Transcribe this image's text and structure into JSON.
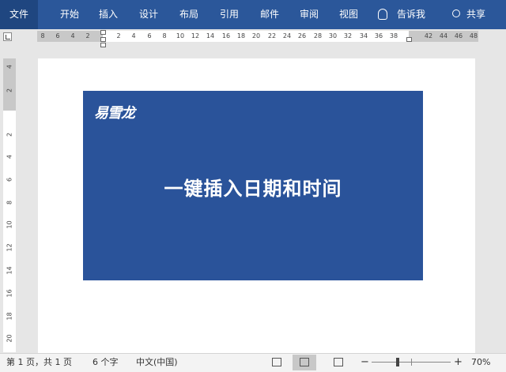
{
  "ribbon": {
    "tabs": [
      "文件",
      "开始",
      "插入",
      "设计",
      "布局",
      "引用",
      "邮件",
      "审阅",
      "视图"
    ],
    "tell_me": "告诉我",
    "share": "共享"
  },
  "ruler": {
    "left_ticks": [
      "8",
      "6",
      "4",
      "2"
    ],
    "main_ticks": [
      "2",
      "4",
      "6",
      "8",
      "10",
      "12",
      "14",
      "16",
      "18",
      "20",
      "22",
      "24",
      "26",
      "28",
      "30",
      "32",
      "34",
      "36",
      "38"
    ],
    "right_ticks": [
      "42",
      "44",
      "46",
      "48"
    ],
    "vertical_ticks": [
      "4",
      "2",
      "2",
      "4",
      "6",
      "8",
      "10",
      "12",
      "14",
      "16",
      "18",
      "20"
    ]
  },
  "document": {
    "banner": {
      "brand": "易雪龙",
      "headline": "一键插入日期和时间",
      "background": "#2a539a"
    }
  },
  "status_bar": {
    "page_info": "第 1 页，共 1 页",
    "word_count": "6 个字",
    "language": "中文(中国)",
    "zoom_minus": "−",
    "zoom_plus": "+",
    "zoom": "70%"
  },
  "colors": {
    "ribbon": "#2b579a",
    "ribbon_active": "#1f4680"
  }
}
